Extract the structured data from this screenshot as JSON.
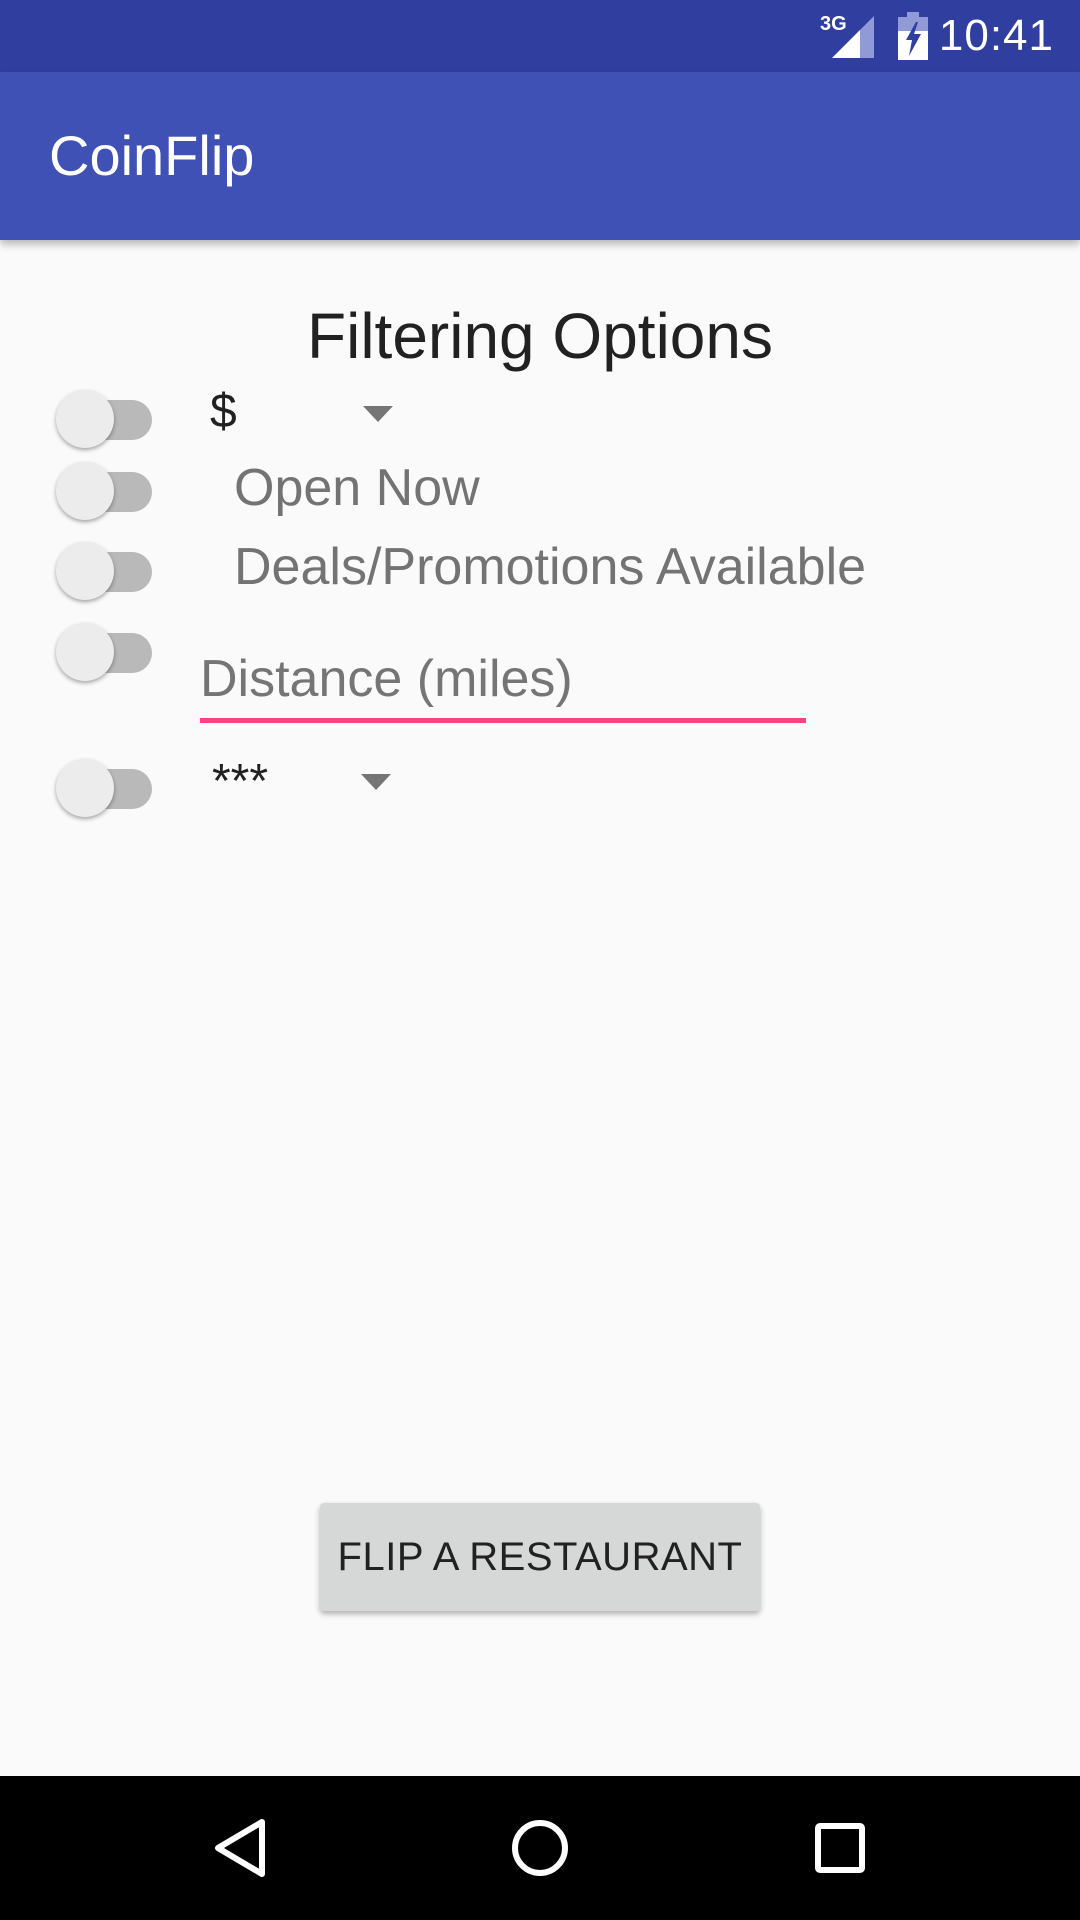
{
  "status_bar": {
    "network": "3G",
    "time": "10:41",
    "icons": [
      "signal-icon",
      "battery-charging-icon"
    ]
  },
  "app_bar": {
    "title": "CoinFlip"
  },
  "filters": {
    "heading": "Filtering Options",
    "price": {
      "enabled": false,
      "selected": "$"
    },
    "open_now": {
      "enabled": false,
      "label": "Open Now"
    },
    "deals": {
      "enabled": false,
      "label": "Deals/Promotions Available"
    },
    "distance": {
      "enabled": false,
      "value": "",
      "placeholder": "Distance (miles)"
    },
    "rating": {
      "enabled": false,
      "selected": "***"
    }
  },
  "action": {
    "flip_label": "FLIP A RESTAURANT"
  },
  "navigation": {
    "buttons": [
      "back-icon",
      "home-icon",
      "recents-icon"
    ]
  },
  "colors": {
    "status_bar": "#303f9f",
    "app_bar": "#3f51b5",
    "accent": "#ff4081",
    "background": "#fafafa"
  }
}
